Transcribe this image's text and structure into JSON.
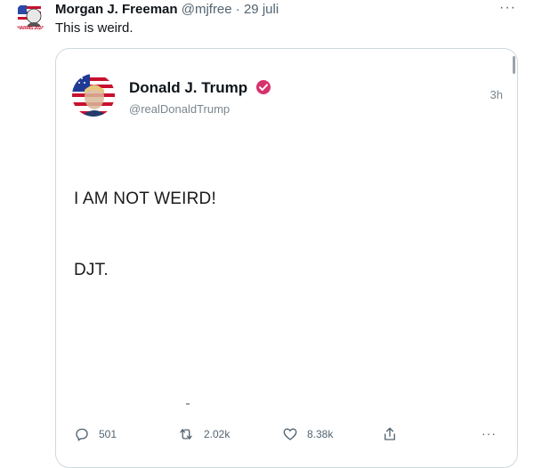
{
  "tweet": {
    "author_name": "Morgan J. Freeman",
    "author_handle": "@mjfree",
    "separator": "·",
    "date": "29 juli",
    "text": "This is weird.",
    "more_label": "···",
    "avatar_badge": "HARRIS 2024"
  },
  "quoted_post": {
    "author_name": "Donald J. Trump",
    "author_handle": "@realDonaldTrump",
    "time": "3h",
    "lines": [
      "I AM NOT WEIRD!",
      "DJT."
    ],
    "actions": {
      "reply_count": "501",
      "repost_count": "2.02k",
      "like_count": "8.38k",
      "more_label": "···"
    }
  },
  "colors": {
    "text": "#0f1419",
    "secondary": "#536471",
    "border": "#cfd9de",
    "verified": "#d6336c"
  },
  "icons": [
    "reply-icon",
    "retweet-icon",
    "heart-icon",
    "share-icon",
    "more-icon",
    "verified-badge-icon"
  ]
}
